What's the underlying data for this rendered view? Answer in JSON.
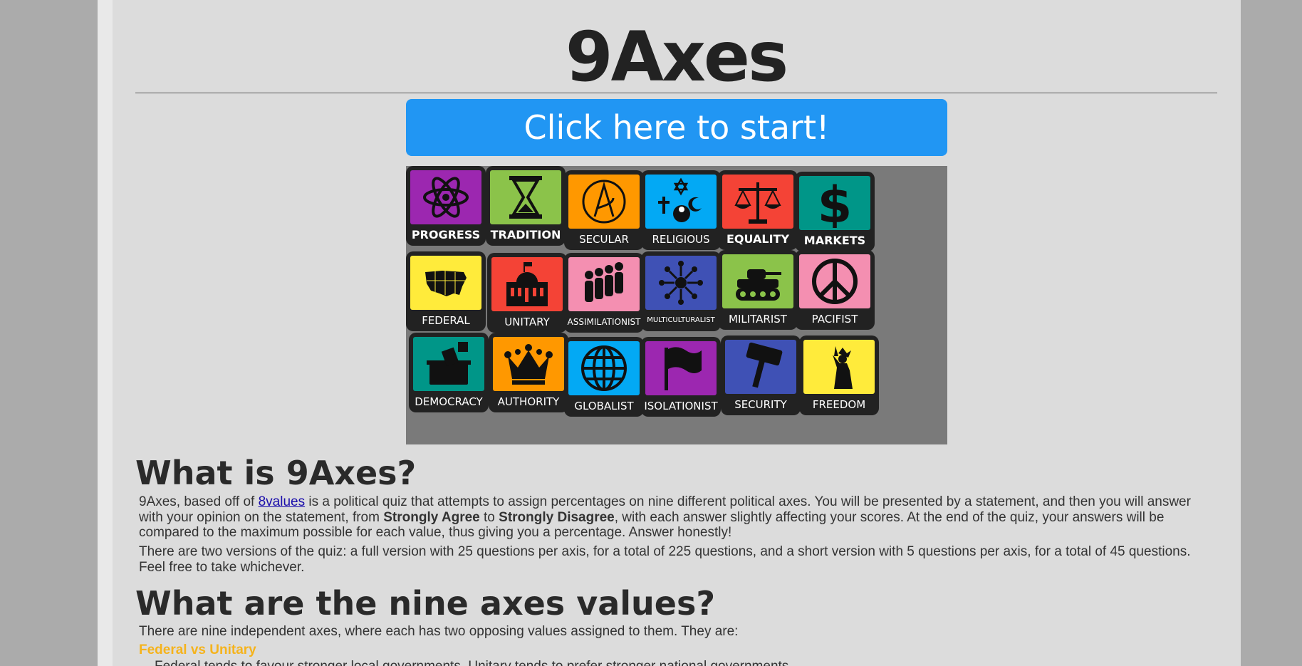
{
  "title": "9Axes",
  "start_button": "Click here to start!",
  "axes_tiles": [
    {
      "label": "PROGRESS",
      "color": "#9c27b0",
      "icon": "atom-icon"
    },
    {
      "label": "TRADITION",
      "color": "#8bc34a",
      "icon": "hourglass-icon"
    },
    {
      "label": "SECULAR",
      "color": "#ff9800",
      "icon": "atheism-icon"
    },
    {
      "label": "RELIGIOUS",
      "color": "#03a9f4",
      "icon": "religions-icon"
    },
    {
      "label": "EQUALITY",
      "color": "#f44336",
      "icon": "scales-icon"
    },
    {
      "label": "MARKETS",
      "color": "#009688",
      "icon": "dollar-icon"
    },
    {
      "label": "FEDERAL",
      "color": "#ffeb3b",
      "icon": "usa-map-icon"
    },
    {
      "label": "UNITARY",
      "color": "#f44336",
      "icon": "capitol-icon"
    },
    {
      "label": "ASSIMILATIONIST",
      "color": "#f48fb1",
      "icon": "people-icon"
    },
    {
      "label": "MULTICULTURALIST",
      "color": "#3f51b5",
      "icon": "circle-people-icon"
    },
    {
      "label": "MILITARIST",
      "color": "#8bc34a",
      "icon": "tank-icon"
    },
    {
      "label": "PACIFIST",
      "color": "#f48fb1",
      "icon": "peace-icon"
    },
    {
      "label": "DEMOCRACY",
      "color": "#009688",
      "icon": "ballot-box-icon"
    },
    {
      "label": "AUTHORITY",
      "color": "#ff9800",
      "icon": "crown-icon"
    },
    {
      "label": "GLOBALIST",
      "color": "#03a9f4",
      "icon": "globe-icon"
    },
    {
      "label": "ISOLATIONIST",
      "color": "#9c27b0",
      "icon": "flag-icon"
    },
    {
      "label": "SECURITY",
      "color": "#3f51b5",
      "icon": "gavel-icon"
    },
    {
      "label": "FREEDOM",
      "color": "#ffeb3b",
      "icon": "liberty-icon"
    }
  ],
  "section1": {
    "heading": "What is 9Axes?",
    "p1_a": "9Axes, based off of ",
    "p1_link": "8values",
    "p1_b": " is a political quiz that attempts to assign percentages on nine different political axes. You will be presented by a statement, and then you will answer with your opinion on the statement, from ",
    "p1_strong1": "Strongly Agree",
    "p1_c": " to ",
    "p1_strong2": "Strongly Disagree",
    "p1_d": ", with each answer slightly affecting your scores. At the end of the quiz, your answers will be compared to the maximum possible for each value, thus giving you a percentage. Answer honestly!",
    "p2": "There are two versions of the quiz: a full version with 25 questions per axis, for a total of 225 questions, and a short version with 5 questions per axis, for a total of 45 questions. Feel free to take whichever."
  },
  "section2": {
    "heading": "What are the nine axes values?",
    "intro": "There are nine independent axes, where each has two opposing values assigned to them. They are:",
    "axis1_title": "Federal vs Unitary",
    "axis1_desc": "Federal tends to favour stronger local governments. Unitary tends to prefer stronger national governments."
  },
  "colors": {
    "accent": "#2196f3",
    "subheading": "#f5b31c",
    "link": "#1a0dab"
  }
}
